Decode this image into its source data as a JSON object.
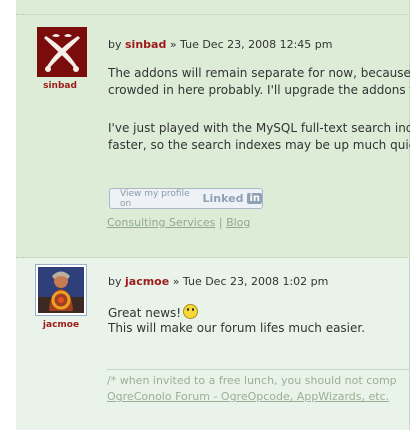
{
  "posts": [
    {
      "author": "sinbad",
      "meta_prefix": "by ",
      "meta_suffix": " » Tue Dec 23, 2008 12:45 pm",
      "avatar_icon": "crossed-swords-icon",
      "body_lines": [
        "The addons will remain separate for now, because t",
        "crowded in here probably. I'll upgrade the addons fo",
        "",
        "I've just played with the MySQL full-text search inde",
        "faster, so the search indexes may be up much quick"
      ],
      "linkedin_badge": {
        "prefix": "View my profile on",
        "word": "Linked",
        "in": "in"
      },
      "signature_links": [
        "Consulting Services",
        "Blog"
      ],
      "signature_separator": "|"
    },
    {
      "author": "jacmoe",
      "meta_prefix": "by ",
      "meta_suffix": " » Tue Dec 23, 2008 1:02 pm",
      "avatar_icon": "warrior-avatar-icon",
      "body_line1": "Great news!",
      "body_line2": "This will make our forum lifes much easier.",
      "smiley_icon": "smile-emoticon-icon",
      "signature_line1": "/* when invited to a free lunch, you should not comp",
      "signature_line2": "OgreConolo Forum - OgreOpcode, AppWizards, etc."
    }
  ],
  "colors": {
    "post_bg_1": "#dcecd7",
    "post_bg_2": "#eaf3e9",
    "author": "#9e1a1a"
  }
}
